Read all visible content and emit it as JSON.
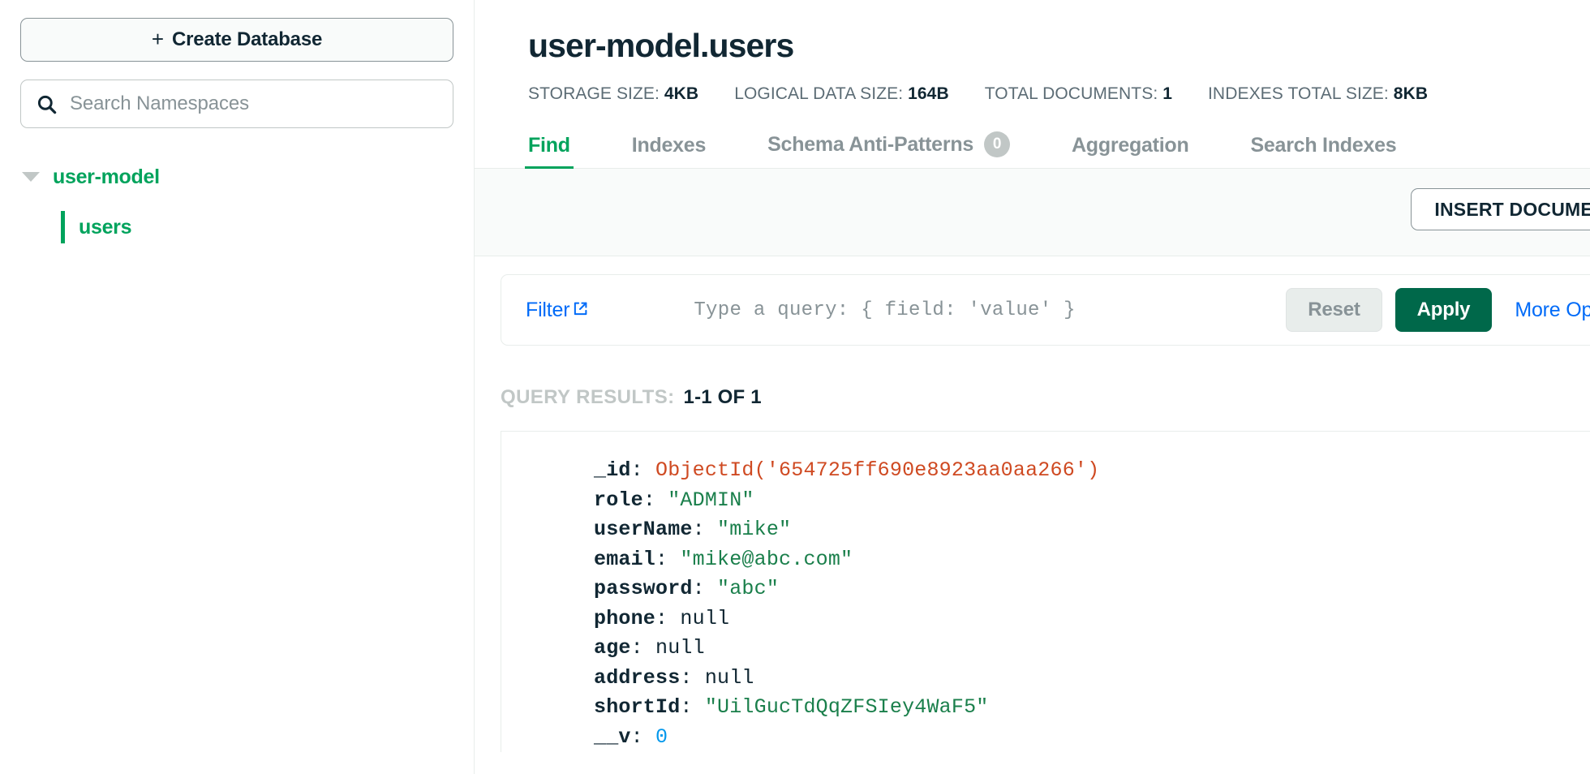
{
  "sidebar": {
    "create_database_button": "Create Database",
    "create_database_plus": "+",
    "search": {
      "placeholder": "Search Namespaces",
      "value": "",
      "icon": "search-icon"
    },
    "tree": {
      "database": "user-model",
      "collections": [
        "users"
      ],
      "expanded": true,
      "active_collection": "users"
    }
  },
  "header": {
    "title": "user-model.users",
    "stats": [
      {
        "label": "STORAGE SIZE:",
        "value": "4KB"
      },
      {
        "label": "LOGICAL DATA SIZE:",
        "value": "164B"
      },
      {
        "label": "TOTAL DOCUMENTS:",
        "value": "1"
      },
      {
        "label": "INDEXES TOTAL SIZE:",
        "value": "8KB"
      }
    ]
  },
  "tabs": [
    {
      "label": "Find",
      "active": true
    },
    {
      "label": "Indexes",
      "active": false
    },
    {
      "label": "Schema Anti-Patterns",
      "active": false,
      "badge": "0"
    },
    {
      "label": "Aggregation",
      "active": false
    },
    {
      "label": "Search Indexes",
      "active": false
    }
  ],
  "toolbar": {
    "insert_document_button": "INSERT DOCUMENT"
  },
  "query_bar": {
    "filter_label": "Filter",
    "filter_icon": "external-link-icon",
    "query_placeholder": "Type a query: { field: 'value' }",
    "query_value": "",
    "reset_button": "Reset",
    "apply_button": "Apply",
    "more_options_link": "More Options"
  },
  "results": {
    "label": "QUERY RESULTS:",
    "count": "1-1 OF 1"
  },
  "document": {
    "fields": [
      {
        "key": "_id",
        "value": "ObjectId('654725ff690e8923aa0aa266')",
        "kind": "objectid"
      },
      {
        "key": "role",
        "value": "\"ADMIN\"",
        "kind": "string"
      },
      {
        "key": "userName",
        "value": "\"mike\"",
        "kind": "string"
      },
      {
        "key": "email",
        "value": "\"mike@abc.com\"",
        "kind": "string"
      },
      {
        "key": "password",
        "value": "\"abc\"",
        "kind": "string"
      },
      {
        "key": "phone",
        "value": "null",
        "kind": "null"
      },
      {
        "key": "age",
        "value": "null",
        "kind": "null"
      },
      {
        "key": "address",
        "value": "null",
        "kind": "null"
      },
      {
        "key": "shortId",
        "value": "\"UilGucTdQqZFSIey4WaF5\"",
        "kind": "string"
      },
      {
        "key": "__v",
        "value": "0",
        "kind": "number"
      }
    ]
  },
  "colors": {
    "brand_green": "#00a35c",
    "apply_green": "#00684a",
    "link_blue": "#016bf8",
    "text_dark": "#112733",
    "text_muted": "#889397",
    "objectid_red": "#cf4a22",
    "string_green": "#1a7f4b",
    "number_blue": "#0498ec"
  }
}
